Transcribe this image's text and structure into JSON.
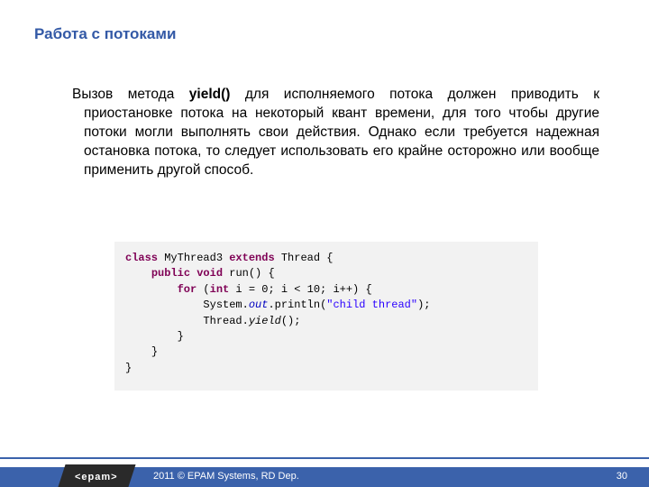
{
  "title": "Работа с потоками",
  "paragraph": {
    "prefix": "Вызов метода ",
    "bold": "yield()",
    "rest": " для исполняемого потока должен приводить к приостановке потока на некоторый квант времени, для того чтобы другие потоки могли выполнять свои действия. Однако если требуется надежная остановка потока, то следует использовать его крайне осторожно или вообще применить другой способ."
  },
  "code": {
    "l1": {
      "kw1": "class",
      "t1": " MyThread3 ",
      "kw2": "extends",
      "t2": " Thread {"
    },
    "l2": {
      "kw1": "public",
      "sp": " ",
      "kw2": "void",
      "t": " run() {"
    },
    "l3": {
      "kw1": "for",
      "t1": " (",
      "kw2": "int",
      "t2": " i = 0; i < 10; i++) {"
    },
    "l4": {
      "t1": "System.",
      "fld": "out",
      "t2": ".println(",
      "str": "\"child thread\"",
      "t3": ");"
    },
    "l5": {
      "t1": "Thread.",
      "mth": "yield",
      "t2": "();"
    },
    "l6": "}",
    "l7": "}",
    "l8": "}"
  },
  "footer": {
    "logo": "<epam>",
    "copyright": "2011 © EPAM Systems, RD Dep.",
    "page": "30"
  }
}
